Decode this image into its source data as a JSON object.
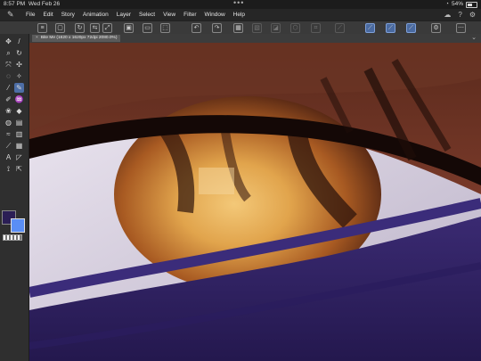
{
  "status": {
    "time": "8:57 PM",
    "date": "Wed Feb 26",
    "battery": "54%",
    "battery_level": 0.54
  },
  "menu": {
    "items": [
      "File",
      "Edit",
      "Story",
      "Animation",
      "Layer",
      "Select",
      "View",
      "Filter",
      "Window",
      "Help"
    ]
  },
  "document": {
    "tab_title": "Bite Me (1620 x 1620px 72dpi 2080.0%)"
  },
  "colors": {
    "main": "#2b1e55",
    "sub": "#5a8ef5",
    "accent": "#4d6ea6"
  },
  "icons": {
    "logo": "clip-studio-logo-icon",
    "command_bar": [
      "menu-icon",
      "fit-icon",
      "rotate-icon",
      "flip-icon",
      "scale-icon",
      "new-icon",
      "open-icon",
      "save-icon",
      "undo-icon",
      "redo-icon",
      "select-all-icon",
      "deselect-icon",
      "fill-icon",
      "transform-icon",
      "crop-icon",
      "adjust-icon",
      "stroke-a-icon",
      "stroke-b-icon",
      "stroke-c-icon",
      "settings-icon",
      "more-icon"
    ]
  }
}
